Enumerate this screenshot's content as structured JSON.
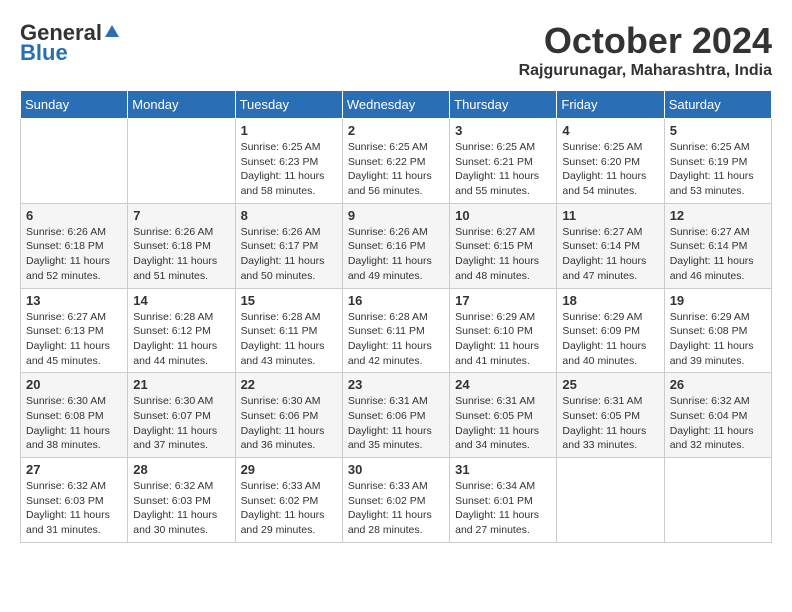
{
  "header": {
    "logo_general": "General",
    "logo_blue": "Blue",
    "month": "October 2024",
    "location": "Rajgurunagar, Maharashtra, India"
  },
  "days_of_week": [
    "Sunday",
    "Monday",
    "Tuesday",
    "Wednesday",
    "Thursday",
    "Friday",
    "Saturday"
  ],
  "weeks": [
    [
      {
        "day": "",
        "info": ""
      },
      {
        "day": "",
        "info": ""
      },
      {
        "day": "1",
        "sunrise": "Sunrise: 6:25 AM",
        "sunset": "Sunset: 6:23 PM",
        "daylight": "Daylight: 11 hours and 58 minutes."
      },
      {
        "day": "2",
        "sunrise": "Sunrise: 6:25 AM",
        "sunset": "Sunset: 6:22 PM",
        "daylight": "Daylight: 11 hours and 56 minutes."
      },
      {
        "day": "3",
        "sunrise": "Sunrise: 6:25 AM",
        "sunset": "Sunset: 6:21 PM",
        "daylight": "Daylight: 11 hours and 55 minutes."
      },
      {
        "day": "4",
        "sunrise": "Sunrise: 6:25 AM",
        "sunset": "Sunset: 6:20 PM",
        "daylight": "Daylight: 11 hours and 54 minutes."
      },
      {
        "day": "5",
        "sunrise": "Sunrise: 6:25 AM",
        "sunset": "Sunset: 6:19 PM",
        "daylight": "Daylight: 11 hours and 53 minutes."
      }
    ],
    [
      {
        "day": "6",
        "sunrise": "Sunrise: 6:26 AM",
        "sunset": "Sunset: 6:18 PM",
        "daylight": "Daylight: 11 hours and 52 minutes."
      },
      {
        "day": "7",
        "sunrise": "Sunrise: 6:26 AM",
        "sunset": "Sunset: 6:18 PM",
        "daylight": "Daylight: 11 hours and 51 minutes."
      },
      {
        "day": "8",
        "sunrise": "Sunrise: 6:26 AM",
        "sunset": "Sunset: 6:17 PM",
        "daylight": "Daylight: 11 hours and 50 minutes."
      },
      {
        "day": "9",
        "sunrise": "Sunrise: 6:26 AM",
        "sunset": "Sunset: 6:16 PM",
        "daylight": "Daylight: 11 hours and 49 minutes."
      },
      {
        "day": "10",
        "sunrise": "Sunrise: 6:27 AM",
        "sunset": "Sunset: 6:15 PM",
        "daylight": "Daylight: 11 hours and 48 minutes."
      },
      {
        "day": "11",
        "sunrise": "Sunrise: 6:27 AM",
        "sunset": "Sunset: 6:14 PM",
        "daylight": "Daylight: 11 hours and 47 minutes."
      },
      {
        "day": "12",
        "sunrise": "Sunrise: 6:27 AM",
        "sunset": "Sunset: 6:14 PM",
        "daylight": "Daylight: 11 hours and 46 minutes."
      }
    ],
    [
      {
        "day": "13",
        "sunrise": "Sunrise: 6:27 AM",
        "sunset": "Sunset: 6:13 PM",
        "daylight": "Daylight: 11 hours and 45 minutes."
      },
      {
        "day": "14",
        "sunrise": "Sunrise: 6:28 AM",
        "sunset": "Sunset: 6:12 PM",
        "daylight": "Daylight: 11 hours and 44 minutes."
      },
      {
        "day": "15",
        "sunrise": "Sunrise: 6:28 AM",
        "sunset": "Sunset: 6:11 PM",
        "daylight": "Daylight: 11 hours and 43 minutes."
      },
      {
        "day": "16",
        "sunrise": "Sunrise: 6:28 AM",
        "sunset": "Sunset: 6:11 PM",
        "daylight": "Daylight: 11 hours and 42 minutes."
      },
      {
        "day": "17",
        "sunrise": "Sunrise: 6:29 AM",
        "sunset": "Sunset: 6:10 PM",
        "daylight": "Daylight: 11 hours and 41 minutes."
      },
      {
        "day": "18",
        "sunrise": "Sunrise: 6:29 AM",
        "sunset": "Sunset: 6:09 PM",
        "daylight": "Daylight: 11 hours and 40 minutes."
      },
      {
        "day": "19",
        "sunrise": "Sunrise: 6:29 AM",
        "sunset": "Sunset: 6:08 PM",
        "daylight": "Daylight: 11 hours and 39 minutes."
      }
    ],
    [
      {
        "day": "20",
        "sunrise": "Sunrise: 6:30 AM",
        "sunset": "Sunset: 6:08 PM",
        "daylight": "Daylight: 11 hours and 38 minutes."
      },
      {
        "day": "21",
        "sunrise": "Sunrise: 6:30 AM",
        "sunset": "Sunset: 6:07 PM",
        "daylight": "Daylight: 11 hours and 37 minutes."
      },
      {
        "day": "22",
        "sunrise": "Sunrise: 6:30 AM",
        "sunset": "Sunset: 6:06 PM",
        "daylight": "Daylight: 11 hours and 36 minutes."
      },
      {
        "day": "23",
        "sunrise": "Sunrise: 6:31 AM",
        "sunset": "Sunset: 6:06 PM",
        "daylight": "Daylight: 11 hours and 35 minutes."
      },
      {
        "day": "24",
        "sunrise": "Sunrise: 6:31 AM",
        "sunset": "Sunset: 6:05 PM",
        "daylight": "Daylight: 11 hours and 34 minutes."
      },
      {
        "day": "25",
        "sunrise": "Sunrise: 6:31 AM",
        "sunset": "Sunset: 6:05 PM",
        "daylight": "Daylight: 11 hours and 33 minutes."
      },
      {
        "day": "26",
        "sunrise": "Sunrise: 6:32 AM",
        "sunset": "Sunset: 6:04 PM",
        "daylight": "Daylight: 11 hours and 32 minutes."
      }
    ],
    [
      {
        "day": "27",
        "sunrise": "Sunrise: 6:32 AM",
        "sunset": "Sunset: 6:03 PM",
        "daylight": "Daylight: 11 hours and 31 minutes."
      },
      {
        "day": "28",
        "sunrise": "Sunrise: 6:32 AM",
        "sunset": "Sunset: 6:03 PM",
        "daylight": "Daylight: 11 hours and 30 minutes."
      },
      {
        "day": "29",
        "sunrise": "Sunrise: 6:33 AM",
        "sunset": "Sunset: 6:02 PM",
        "daylight": "Daylight: 11 hours and 29 minutes."
      },
      {
        "day": "30",
        "sunrise": "Sunrise: 6:33 AM",
        "sunset": "Sunset: 6:02 PM",
        "daylight": "Daylight: 11 hours and 28 minutes."
      },
      {
        "day": "31",
        "sunrise": "Sunrise: 6:34 AM",
        "sunset": "Sunset: 6:01 PM",
        "daylight": "Daylight: 11 hours and 27 minutes."
      },
      {
        "day": "",
        "info": ""
      },
      {
        "day": "",
        "info": ""
      }
    ]
  ]
}
